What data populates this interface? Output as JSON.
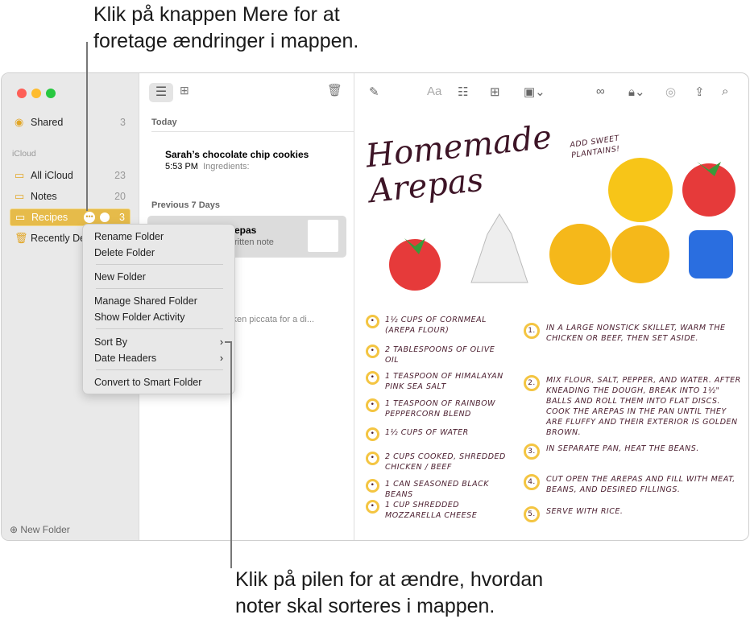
{
  "callouts": {
    "top": "Klik på knappen Mere for at foretage ændringer i mappen.",
    "top_l1": "Klik på knappen Mere for at",
    "top_l2": "foretage ændringer i mappen.",
    "bottom_l1": "Klik på pilen for at ændre, hvordan",
    "bottom_l2": "noter skal sorteres i mappen."
  },
  "sidebar": {
    "shared": {
      "label": "Shared",
      "count": "3"
    },
    "section": "iCloud",
    "items": [
      {
        "label": "All iCloud",
        "count": "23"
      },
      {
        "label": "Notes",
        "count": "20"
      },
      {
        "label": "Recipes",
        "count": "3"
      },
      {
        "label": "Recently Deleted"
      }
    ],
    "new_folder": "New Folder"
  },
  "list": {
    "today": "Today",
    "note1": {
      "title": "Sarah’s chocolate chip cookies",
      "time": "5:53 PM",
      "preview": "Ingredients:"
    },
    "prev7": "Previous 7 Days",
    "note2": {
      "title": "Homemade Arepas",
      "title_visible": "epas",
      "preview": "ritten note"
    },
    "note3_preview": "cken piccata for a di..."
  },
  "menu": {
    "items": [
      "Rename Folder",
      "Delete Folder",
      "New Folder",
      "Manage Shared Folder",
      "Show Folder Activity",
      "Sort By",
      "Date Headers",
      "Convert to Smart Folder"
    ]
  },
  "recipe": {
    "title": "Homemade Arepas",
    "aside": "Add sweet plantains!",
    "ingredients": [
      "1½ cups of cornmeal (arepa flour)",
      "2 tablespoons of olive oil",
      "1 teaspoon of Himalayan pink sea salt",
      "1 teaspoon of rainbow peppercorn blend",
      "1½ cups of water",
      "2 cups cooked, shredded chicken / beef",
      "1 can seasoned black beans",
      "1 cup shredded mozzarella cheese"
    ],
    "steps": [
      {
        "n": "1.",
        "t": "In a large nonstick skillet, warm the chicken or beef, then set aside."
      },
      {
        "n": "2.",
        "t": "Mix flour, salt, pepper, and water. After kneading the dough, break into 1½\" balls and roll them into flat discs. Cook the arepas in the pan until they are fluffy and their exterior is golden brown."
      },
      {
        "n": "3.",
        "t": "In separate pan, heat the beans."
      },
      {
        "n": "4.",
        "t": "Cut open the arepas and fill with meat, beans, and desired fillings."
      },
      {
        "n": "5.",
        "t": "Serve with rice."
      }
    ]
  },
  "colors": {
    "accent": "#e6bb4a",
    "sidebar": "#e9e9e9",
    "ink": "#4a1d2e"
  }
}
